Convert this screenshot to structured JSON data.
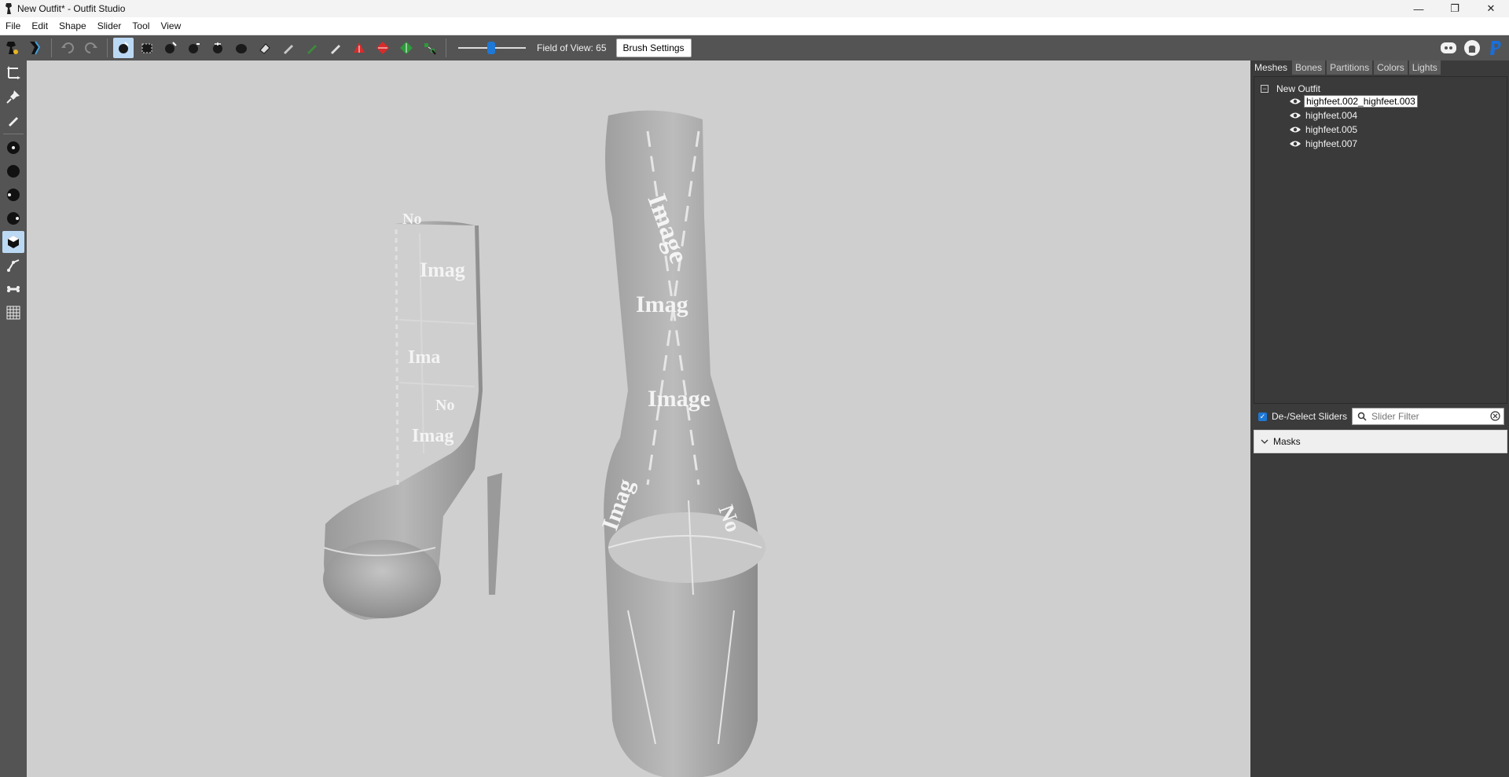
{
  "window": {
    "title": "New Outfit* - Outfit Studio",
    "controls": [
      "minimize-icon",
      "restore-icon",
      "close-icon"
    ]
  },
  "menu": [
    "File",
    "Edit",
    "Shape",
    "Slider",
    "Tool",
    "View"
  ],
  "toolbar": {
    "fov_label": "Field of View: 65",
    "fov_value": 65,
    "brush_settings_label": "Brush Settings",
    "tools": [
      "load-reference-icon",
      "load-outfit-icon",
      "undo-icon",
      "redo-icon",
      "select-brush-icon",
      "mask-brush-icon",
      "inflate-brush-icon",
      "deflate-brush-icon",
      "move-brush-icon",
      "smooth-brush-icon",
      "undiff-brush-icon",
      "weight-brush-icon",
      "color-brush-icon",
      "alpha-brush-icon",
      "transform-icon",
      "pivot-icon",
      "vertex-select-icon"
    ],
    "external": [
      "discord-icon",
      "github-icon",
      "paypal-icon"
    ]
  },
  "left_tools": [
    "move-icon",
    "pin-icon",
    "pencil-icon",
    "dot-small-icon",
    "dot-large-icon",
    "dot-half-icon",
    "dot-quarter-icon",
    "cube-icon",
    "edge-icon",
    "bone-icon",
    "grid-icon"
  ],
  "panel": {
    "tabs": [
      "Meshes",
      "Bones",
      "Partitions",
      "Colors",
      "Lights"
    ],
    "active_tab": "Meshes",
    "tree_root": "New Outfit",
    "meshes": [
      "highfeet.002_highfeet.003",
      "highfeet.004",
      "highfeet.005",
      "highfeet.007"
    ],
    "selected_mesh": "highfeet.002_highfeet.003",
    "deselect_label": "De-/Select Sliders",
    "slider_filter_placeholder": "Slider Filter",
    "masks_label": "Masks"
  },
  "colors": {
    "viewport_bg": "#cfcfcf",
    "panel_bg": "#3b3b3b",
    "toolbar_bg": "#545454",
    "accent": "#1d78d6"
  }
}
